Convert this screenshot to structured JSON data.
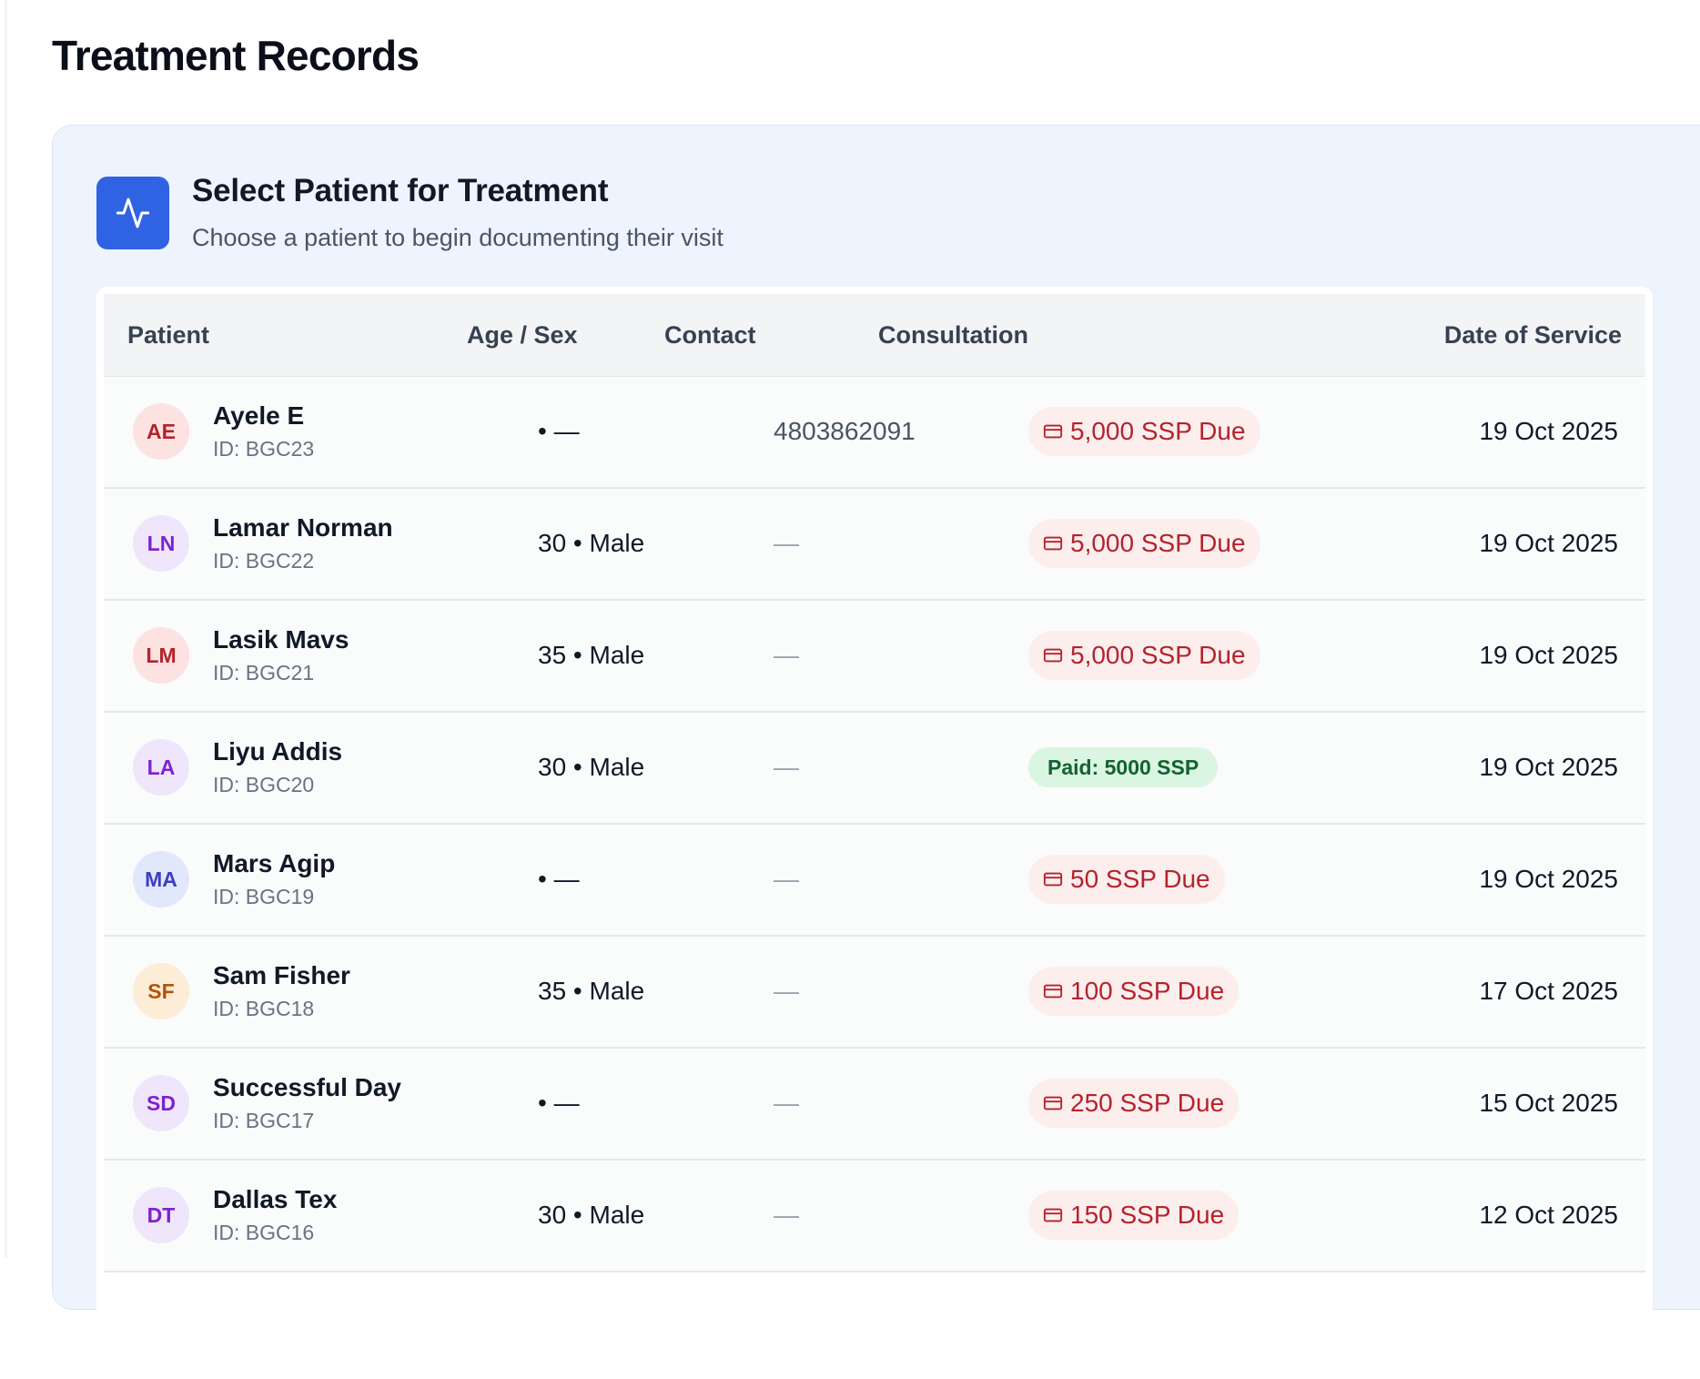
{
  "page": {
    "title": "Treatment Records"
  },
  "card": {
    "icon": "activity-icon",
    "title": "Select Patient for Treatment",
    "subtitle": "Choose a patient to begin documenting their visit"
  },
  "table": {
    "columns": [
      "Patient",
      "Age / Sex",
      "Contact",
      "Consultation",
      "Date of Service"
    ],
    "rows": [
      {
        "initials": "AE",
        "name": "Ayele E",
        "id": "ID: BGC23",
        "age_sex": "• —",
        "contact": "4803862091",
        "consultation": "5,000 SSP Due",
        "status": "due",
        "date": "19 Oct 2025",
        "avatar_bg": "#fde2e2",
        "avatar_fg": "#b4232c"
      },
      {
        "initials": "LN",
        "name": "Lamar Norman",
        "id": "ID: BGC22",
        "age_sex": "30 • Male",
        "contact": "—",
        "consultation": "5,000 SSP Due",
        "status": "due",
        "date": "19 Oct 2025",
        "avatar_bg": "#efe6fb",
        "avatar_fg": "#7e22ce"
      },
      {
        "initials": "LM",
        "name": "Lasik Mavs",
        "id": "ID: BGC21",
        "age_sex": "35 • Male",
        "contact": "—",
        "consultation": "5,000 SSP Due",
        "status": "due",
        "date": "19 Oct 2025",
        "avatar_bg": "#fde2e2",
        "avatar_fg": "#b4232c"
      },
      {
        "initials": "LA",
        "name": "Liyu Addis",
        "id": "ID: BGC20",
        "age_sex": "30 • Male",
        "contact": "—",
        "consultation": "Paid: 5000 SSP",
        "status": "paid",
        "date": "19 Oct 2025",
        "avatar_bg": "#efe6fb",
        "avatar_fg": "#7e22ce"
      },
      {
        "initials": "MA",
        "name": "Mars Agip",
        "id": "ID: BGC19",
        "age_sex": "• —",
        "contact": "—",
        "consultation": "50 SSP Due",
        "status": "due",
        "date": "19 Oct 2025",
        "avatar_bg": "#e2e7fb",
        "avatar_fg": "#3b3fc0"
      },
      {
        "initials": "SF",
        "name": "Sam Fisher",
        "id": "ID: BGC18",
        "age_sex": "35 • Male",
        "contact": "—",
        "consultation": "100 SSP Due",
        "status": "due",
        "date": "17 Oct 2025",
        "avatar_bg": "#fdecd6",
        "avatar_fg": "#b45309"
      },
      {
        "initials": "SD",
        "name": "Successful Day",
        "id": "ID: BGC17",
        "age_sex": "• —",
        "contact": "—",
        "consultation": "250 SSP Due",
        "status": "due",
        "date": "15 Oct 2025",
        "avatar_bg": "#efe6fb",
        "avatar_fg": "#7e22ce"
      },
      {
        "initials": "DT",
        "name": "Dallas Tex",
        "id": "ID: BGC16",
        "age_sex": "30 • Male",
        "contact": "—",
        "consultation": "150 SSP Due",
        "status": "due",
        "date": "12 Oct 2025",
        "avatar_bg": "#efe6fb",
        "avatar_fg": "#7e22ce"
      }
    ]
  },
  "colors": {
    "accent": "#2f63e3",
    "due_bg": "#fdeeee",
    "due_text": "#b4232c",
    "paid_bg": "#daf5e2",
    "paid_text": "#14622f",
    "card_bg": "#eef4fe"
  }
}
